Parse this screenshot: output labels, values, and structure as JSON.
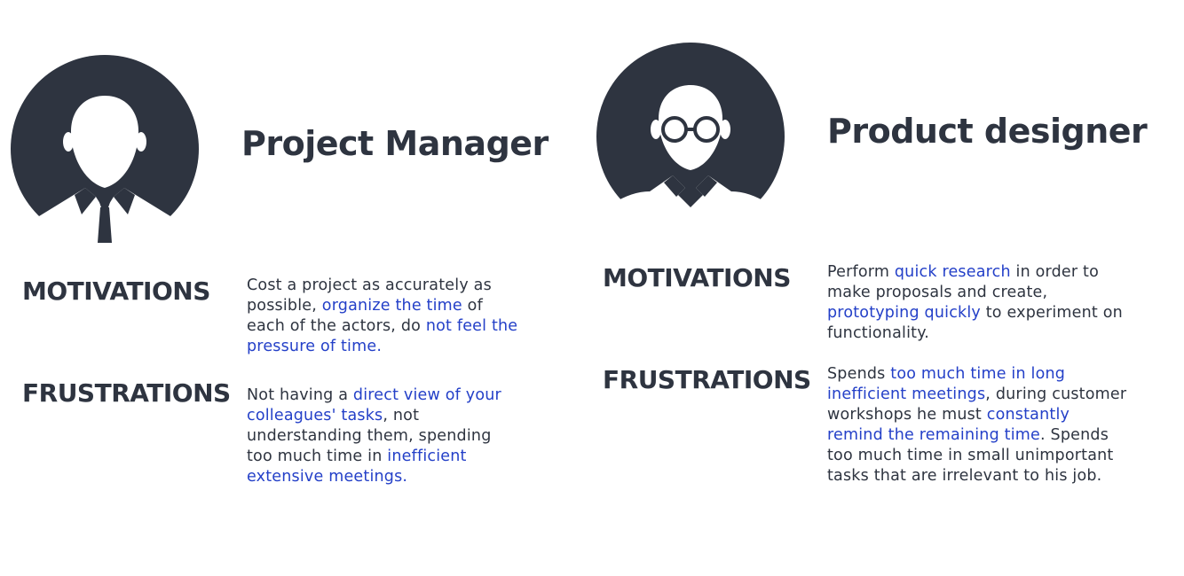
{
  "colors": {
    "dark": "#2e3440",
    "highlight": "#2440c8",
    "background": "#ffffff"
  },
  "personas": [
    {
      "title": "Project Manager",
      "avatar_icon": "manager-with-tie-avatar",
      "motivations": {
        "label": "MOTIVATIONS",
        "t0": "Cost a project as accurately as possible, ",
        "h0": "organize the time",
        "t1": " of each of the actors, do ",
        "h1": "not feel the pressure of time."
      },
      "frustrations": {
        "label": "FRUSTRATIONS",
        "t0": "Not having a ",
        "h0": "direct view of your colleagues' tasks",
        "t1": ", not understanding them, spending too much time in ",
        "h1": "inefficient extensive meetings."
      }
    },
    {
      "title": "Product designer",
      "avatar_icon": "designer-with-glasses-avatar",
      "motivations": {
        "label": "MOTIVATIONS",
        "t0": "Perform ",
        "h0": "quick research",
        "t1": " in order to make proposals and create, ",
        "h1": "prototyping quickly",
        "t2": " to experiment on functionality."
      },
      "frustrations": {
        "label": "FRUSTRATIONS",
        "t0": "Spends ",
        "h0": "too much time in long inefficient meetings",
        "t1": ", during customer workshops he must ",
        "h1": "constantly remind the remaining time",
        "t2": ". Spends too much time in small unimportant tasks that are irrelevant to his job."
      }
    }
  ]
}
